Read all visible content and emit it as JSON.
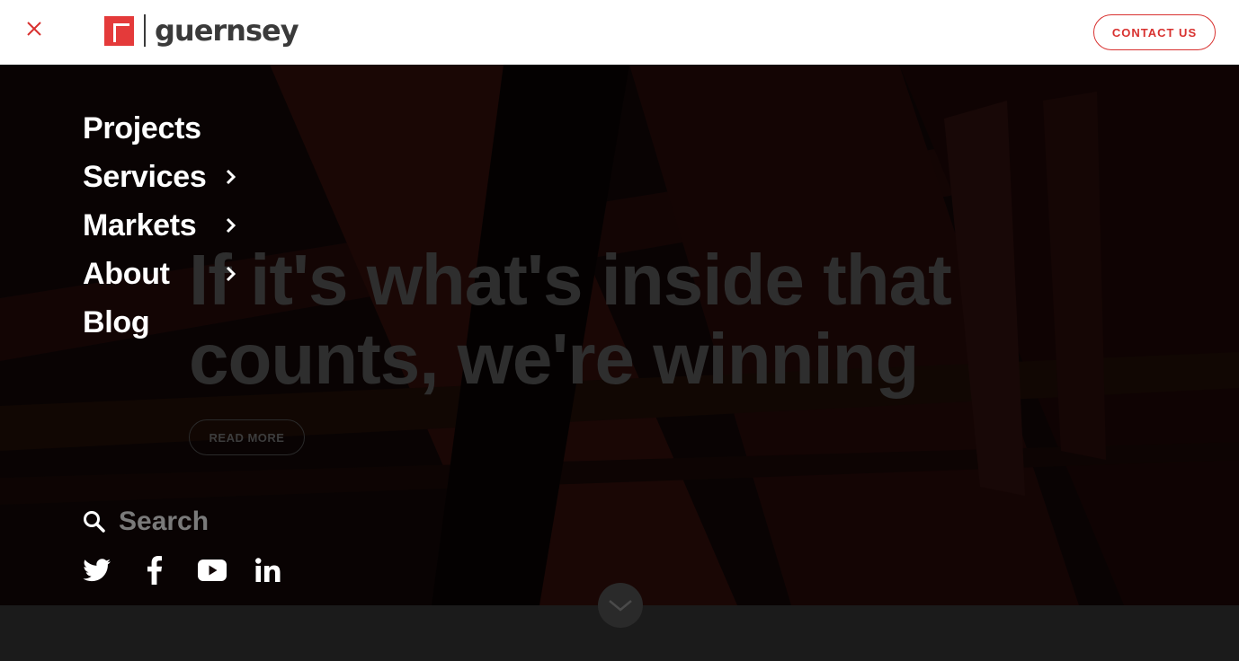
{
  "header": {
    "logo_text": "guernsey",
    "contact_label": "CONTACT US",
    "close_icon": "close-icon",
    "accent_color": "#d8312f"
  },
  "menu": {
    "items": [
      {
        "label": "Projects",
        "has_submenu": false
      },
      {
        "label": "Services",
        "has_submenu": true
      },
      {
        "label": "Markets",
        "has_submenu": true
      },
      {
        "label": "About",
        "has_submenu": true
      },
      {
        "label": "Blog",
        "has_submenu": false
      }
    ],
    "search_placeholder": "Search",
    "social": [
      "twitter-icon",
      "facebook-icon",
      "youtube-icon",
      "linkedin-icon"
    ]
  },
  "hero": {
    "title": "If it's what's inside that counts, we're winning",
    "read_more_label": "READ MORE"
  }
}
